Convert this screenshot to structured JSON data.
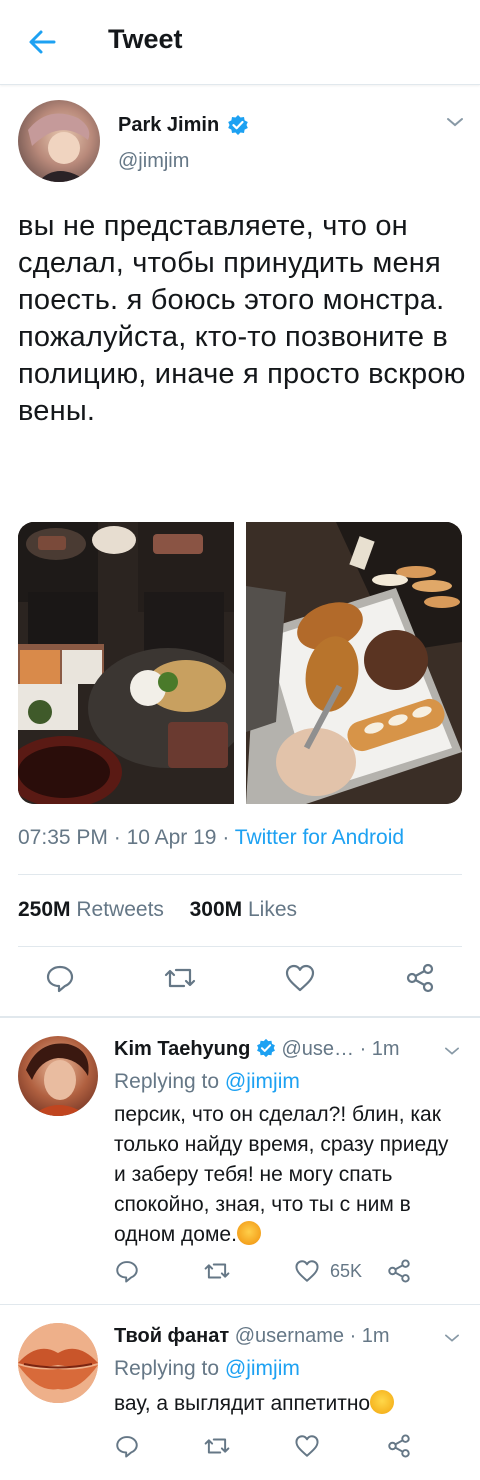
{
  "header": {
    "title": "Tweet"
  },
  "tweet": {
    "author_name": "Park Jimin",
    "handle": "@jimjim",
    "text": "вы не представляете, что он сделал, чтобы принудить меня поесть. я боюсь этого монстра. пожалуйста, кто-то позвоните в полицию, иначе я просто вскрою вены.",
    "time": "07:35 PM",
    "date": "10 Apr 19",
    "source": "Twitter for Android",
    "retweets_count": "250M",
    "retweets_label": "Retweets",
    "likes_count": "300M",
    "likes_label": "Likes"
  },
  "replies": [
    {
      "author_name": "Kim Taehyung",
      "handle": "@use…",
      "time": "1m",
      "replying_label": "Replying to",
      "replying_handle": "@jimjim",
      "text": "персик, что он сделал?! блин, как только найду время, сразу приеду и заберу тебя! не могу спать спокойно, зная, что ты с ним в одном доме.",
      "like_count": "65K"
    },
    {
      "author_name": "Твой фанат",
      "handle": "@username",
      "time": "1m",
      "replying_label": "Replying to",
      "replying_handle": "@jimjim",
      "text": "вау, а выглядит аппетитно",
      "like_count": ""
    }
  ],
  "separator": "·",
  "colors": {
    "accent": "#1da1f2",
    "muted": "#657786",
    "divider": "#e1e8ed"
  }
}
